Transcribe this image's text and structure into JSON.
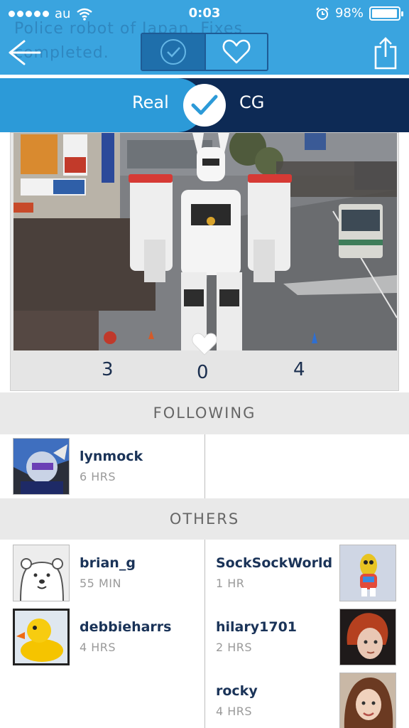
{
  "status_bar": {
    "carrier": "au",
    "time": "0:03",
    "battery_percent": "98%",
    "battery_level": 0.98
  },
  "background_caption": "Police robot of Japan. Fixes completed.",
  "nav": {
    "back_icon": "back-arrow-icon",
    "share_icon": "share-icon",
    "segments": [
      {
        "icon": "check-circle-icon",
        "active": true
      },
      {
        "icon": "heart-icon",
        "active": false
      }
    ]
  },
  "toggle": {
    "left_label": "Real",
    "right_label": "CG",
    "selected": "Real"
  },
  "post": {
    "count_left": "3",
    "count_middle": "0",
    "count_right": "4"
  },
  "following": {
    "title": "FOLLOWING",
    "users": [
      {
        "name": "lynmock",
        "time": "6 HRS"
      }
    ]
  },
  "others": {
    "title": "OTHERS",
    "left_users": [
      {
        "name": "brian_g",
        "time": "55 MIN"
      },
      {
        "name": "debbieharrs",
        "time": "4 HRS"
      }
    ],
    "right_users": [
      {
        "name": "SockSockWorld",
        "time": "1 HR"
      },
      {
        "name": "hilary1701",
        "time": "2 HRS"
      },
      {
        "name": "rocky",
        "time": "4 HRS"
      }
    ]
  },
  "colors": {
    "top_blue": "#3aa4df",
    "toggle_dark": "#0d2a55",
    "toggle_light": "#2c9ad8",
    "name_text": "#1a3358",
    "section_bg": "#e9e9e9"
  }
}
